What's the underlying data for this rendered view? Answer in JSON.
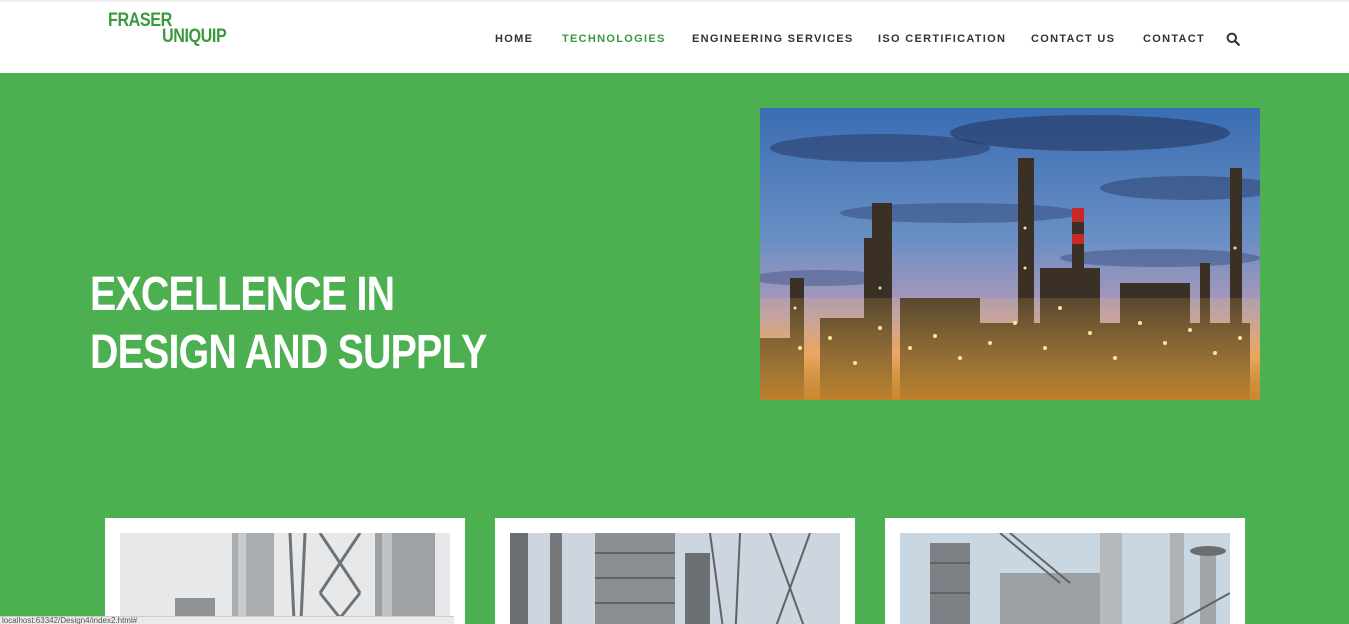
{
  "logo": {
    "line1": "FRASER",
    "line2": "UNIQUIP"
  },
  "nav": {
    "items": [
      {
        "label": "HOME",
        "active": false
      },
      {
        "label": "TECHNOLOGIES",
        "active": true
      },
      {
        "label": "ENGINEERING SERVICES",
        "active": false
      },
      {
        "label": "ISO CERTIFICATION",
        "active": false
      },
      {
        "label": "CONTACT US",
        "active": false
      },
      {
        "label": "CONTACT",
        "active": false
      }
    ],
    "search_icon": "search-icon"
  },
  "hero": {
    "title_line1": "EXCELLENCE IN",
    "title_line2": "DESIGN AND SUPPLY",
    "image": "industrial-refinery-at-dusk"
  },
  "cards": [
    {
      "image": "storage-tanks"
    },
    {
      "image": "power-plant-structure"
    },
    {
      "image": "industrial-chimneys"
    }
  ],
  "status_bar": {
    "text": "localhost:63342/Design4/index2.html#"
  },
  "colors": {
    "brand_green": "#4caf50",
    "logo_green": "#3c9a3e",
    "nav_text": "#333333"
  }
}
